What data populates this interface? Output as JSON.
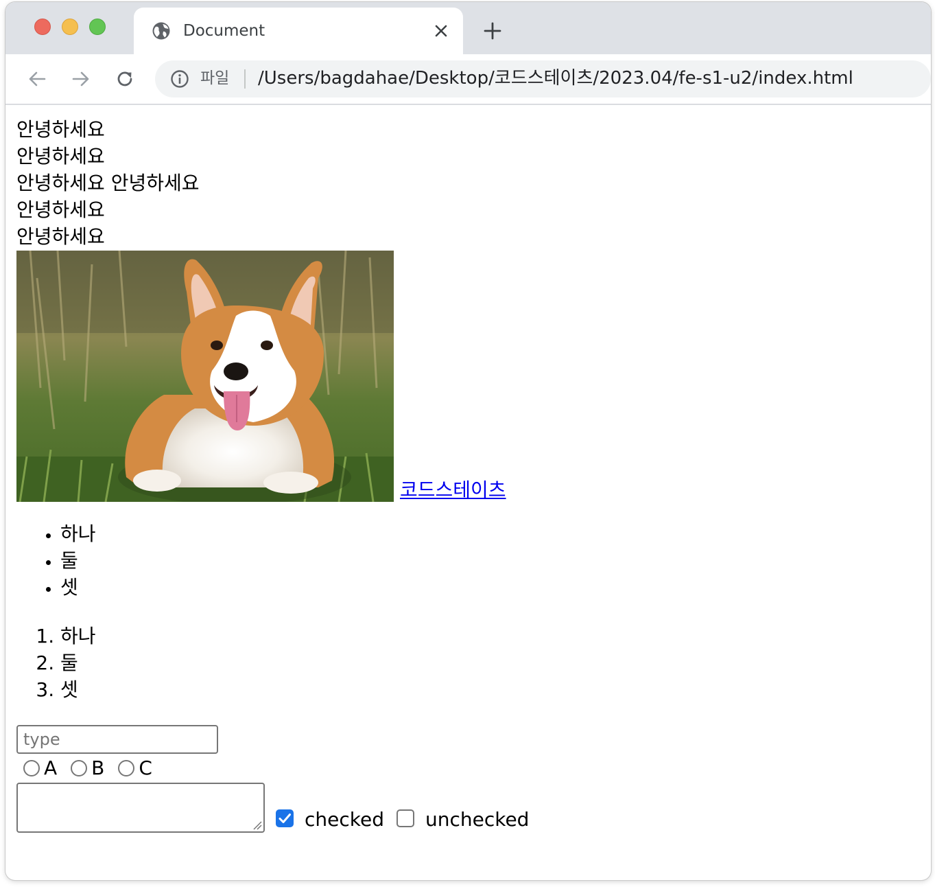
{
  "browser": {
    "tab_title": "Document",
    "address": {
      "scheme_label": "파일",
      "url": "/Users/bagdahae/Desktop/코드스테이츠/2023.04/fe-s1-u2/index.html"
    },
    "icons": {
      "favicon": "globe-icon",
      "close": "close-icon",
      "new_tab": "plus-icon",
      "back": "arrow-left-icon",
      "forward": "arrow-right-icon",
      "reload": "reload-icon",
      "info": "info-icon"
    },
    "colors": {
      "tabstrip": "#dee1e6",
      "omnibox": "#f1f3f4",
      "close": "#ed6a5e",
      "minimize": "#f5bf4f",
      "zoom": "#62c554"
    }
  },
  "page": {
    "lines": [
      "안녕하세요",
      "안녕하세요",
      "안녕하세요 안녕하세요",
      "안녕하세요",
      "안녕하세요"
    ],
    "image_subject": "corgi-dog-photo",
    "link_text": "코드스테이츠",
    "link_color": "#0000ee",
    "unordered_list": [
      "하나",
      "둘",
      "셋"
    ],
    "ordered_list": [
      "하나",
      "둘",
      "셋"
    ],
    "form": {
      "text_input_placeholder": "type",
      "text_input_value": "",
      "radios": [
        {
          "label": "A",
          "checked": false
        },
        {
          "label": "B",
          "checked": false
        },
        {
          "label": "C",
          "checked": false
        }
      ],
      "textarea_value": "",
      "checkbox_checked_label": "checked",
      "checkbox_unchecked_label": "unchecked",
      "checkbox_color": "#1a73e8"
    }
  }
}
